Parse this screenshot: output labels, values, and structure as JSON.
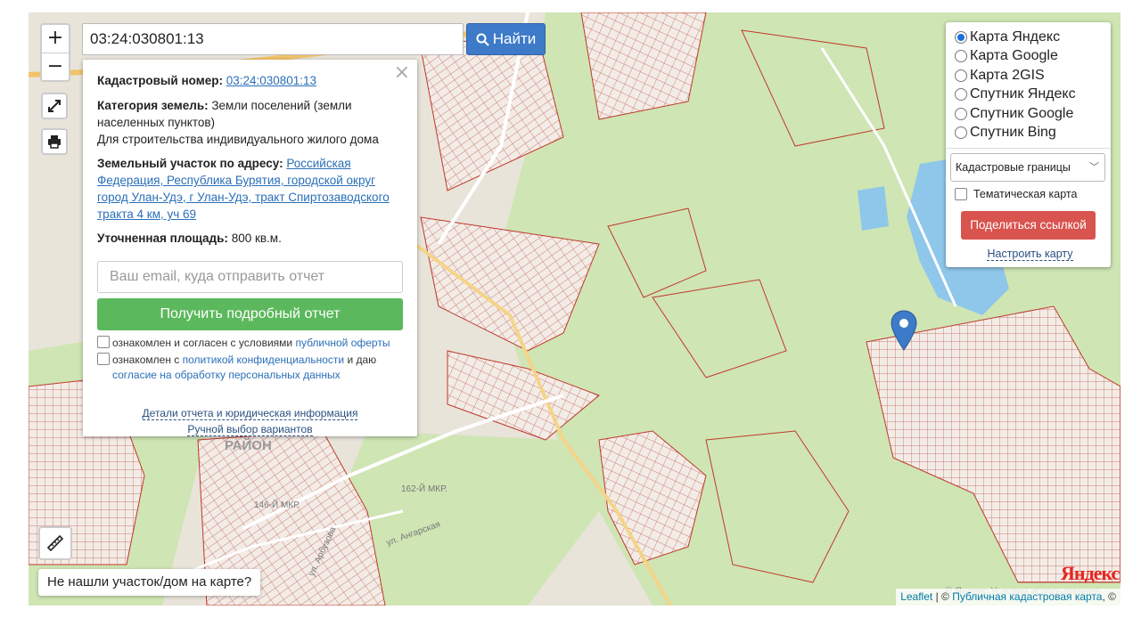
{
  "search": {
    "value": "03:24:030801:13",
    "button_label": "Найти"
  },
  "zoom": {
    "in_label": "+",
    "out_label": "−"
  },
  "controls": {
    "fullscreen_icon": "expand-icon",
    "print_icon": "printer-icon",
    "ruler_icon": "ruler-icon"
  },
  "popup": {
    "close_label": "×",
    "cadastral_label": "Кадастровый номер:",
    "cadastral_value": "03:24:030801:13",
    "category_label": "Категория земель:",
    "category_value": "Земли поселений (земли населенных пунктов)",
    "purpose": "Для строительства индивидуального жилого дома",
    "address_label": "Земельный участок по адресу:",
    "address_value": "Российская Федерация, Республика Бурятия, городской округ город Улан-Удэ, г Улан-Удэ, тракт Спиртозаводского тракта 4 км, уч 69",
    "area_label": "Уточненная площадь:",
    "area_value": "800 кв.м.",
    "email_placeholder": "Ваш email, куда отправить отчет",
    "report_button": "Получить подробный отчет",
    "agree1_text": "ознакомлен и согласен с условиями",
    "agree1_link": "публичной оферты",
    "agree2_text": "ознакомлен с",
    "agree2_link": "политикой конфиденциальности",
    "agree2_text2": "и даю",
    "agree2_link2": "согласие на обработку персональных данных",
    "details_link": "Детали отчета и юридическая информация",
    "manual_link": "Ручной выбор вариантов"
  },
  "layers": {
    "options": [
      {
        "label": "Карта Яндекс",
        "selected": true
      },
      {
        "label": "Карта Google",
        "selected": false
      },
      {
        "label": "Карта 2GIS",
        "selected": false
      },
      {
        "label": "Спутник Яндекс",
        "selected": false
      },
      {
        "label": "Спутник Google",
        "selected": false
      },
      {
        "label": "Спутник Bing",
        "selected": false
      }
    ],
    "overlay_select": "Кадастровые границы",
    "thematic_label": "Тематическая карта",
    "share_button": "Поделиться ссылкой",
    "setup_link": "Настроить карту"
  },
  "not_found_button": "Не нашли участок/дом на карте?",
  "attribution": {
    "leaflet": "Leaflet",
    "sep": " | © ",
    "pkk": "Публичная кадастровая карта",
    "tail": ", ©"
  },
  "map_labels": {
    "district": "РАЙОН",
    "mkr146": "146-Й МКР.",
    "mkr162": "162-Й МКР.",
    "street_angarskaya": "ул. Ангарская",
    "street_arbuzov": "ул. Арбузова",
    "yandex": "Яндекс",
    "yandex_terms": "© Яндекс  Условия использования"
  },
  "colors": {
    "accent": "#3d7ac7",
    "green_button": "#5cb85c",
    "red_button": "#d9534f",
    "parcel": "#c0392b",
    "park": "#cfe5b4"
  }
}
